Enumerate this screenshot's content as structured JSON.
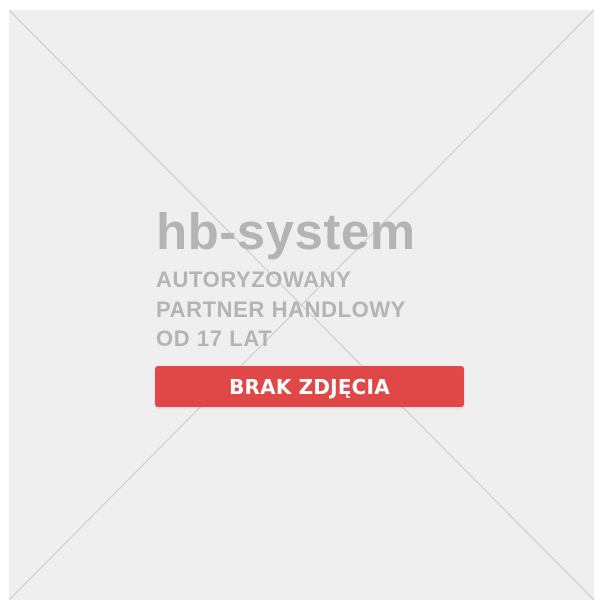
{
  "placeholder": {
    "logo_text": "hb-system",
    "tagline_lines": [
      "AUTORYZOWANY",
      "PARTNER HANDLOWY",
      "OD 17 LAT"
    ],
    "badge_label": "BRAK ZDJĘCIA"
  },
  "colors": {
    "background": "#efefef",
    "cross_lines": "#c8c8c8",
    "logo_text": "#b4b4b4",
    "badge_background": "#e04848",
    "badge_text": "#ffffff"
  }
}
